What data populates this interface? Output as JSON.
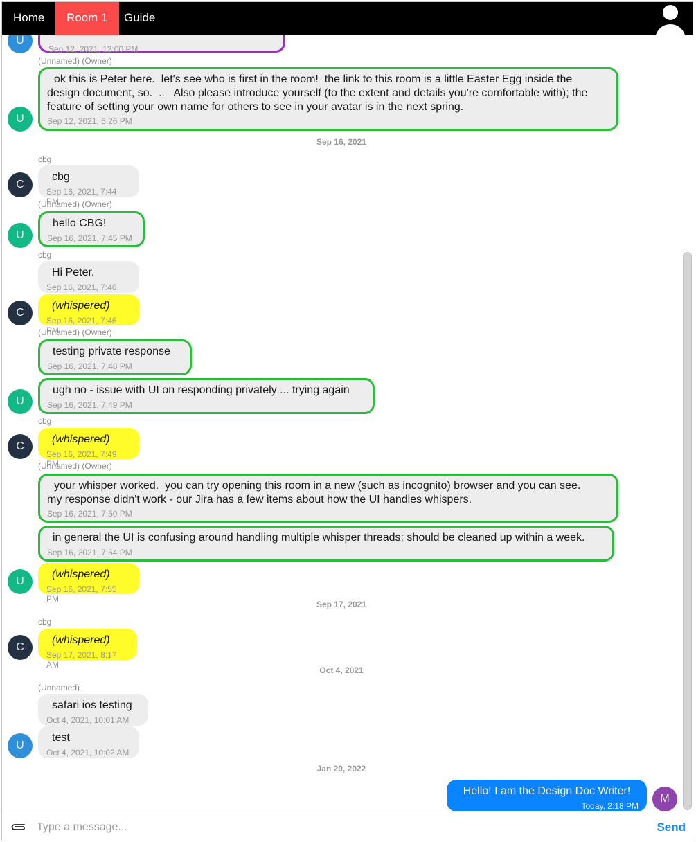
{
  "nav": {
    "tabs": [
      {
        "label": "Home"
      },
      {
        "label": "Room 1"
      },
      {
        "label": "Guide"
      }
    ]
  },
  "messages": {
    "m0": {
      "ts": "Sep 12, 2021, 12:00 PM",
      "avatar": "U"
    },
    "m1": {
      "author": "(Unnamed) (Owner)",
      "text": "ok this is Peter here.  let's see who is first in the room!  the link to this room is a little Easter Egg inside the\ndesign document, so.  ..   Also please introduce yourself (to the extent and details you're comfortable with); the\nfeature of setting your own name for others to see in your avatar is in the next spring.",
      "ts": "Sep 12, 2021, 6:26 PM",
      "avatar": "U"
    },
    "d1": "Sep 16, 2021",
    "m2": {
      "author": "cbg",
      "text": "cbg",
      "ts": "Sep 16, 2021, 7:44 PM",
      "avatar": "C"
    },
    "m3": {
      "author": "(Unnamed) (Owner)",
      "text": "hello CBG!",
      "ts": "Sep 16, 2021, 7:45 PM",
      "avatar": "U"
    },
    "m4": {
      "author": "cbg",
      "text": "Hi Peter.",
      "ts": "Sep 16, 2021, 7:46 PM"
    },
    "m5": {
      "text": "(whispered)",
      "ts": "Sep 16, 2021, 7:46 PM",
      "avatar": "C"
    },
    "m6": {
      "author": "(Unnamed) (Owner)",
      "text": "testing private response",
      "ts": "Sep 16, 2021, 7:48 PM"
    },
    "m7": {
      "text": "ugh no - issue with UI on responding privately ... trying again",
      "ts": "Sep 16, 2021, 7:49 PM",
      "avatar": "U"
    },
    "m8": {
      "author": "cbg",
      "text": "(whispered)",
      "ts": "Sep 16, 2021, 7:49 PM",
      "avatar": "C"
    },
    "m9": {
      "author": "(Unnamed) (Owner)",
      "text": "your whisper worked.  you can try opening this room in a new (such as incognito) browser and you can see.\nmy response didn't work - our Jira has a few items about how the UI handles whispers.",
      "ts": "Sep 16, 2021, 7:50 PM"
    },
    "m10": {
      "text": "in general the UI is confusing around handling multiple whisper threads; should be cleaned up within a week.",
      "ts": "Sep 16, 2021, 7:54 PM"
    },
    "m11": {
      "text": "(whispered)",
      "ts": "Sep 16, 2021, 7:55 PM",
      "avatar": "U"
    },
    "d2": "Sep 17, 2021",
    "m12": {
      "author": "cbg",
      "text": "(whispered)",
      "ts": "Sep 17, 2021, 8:17 AM",
      "avatar": "C"
    },
    "d3": "Oct 4, 2021",
    "m13": {
      "author": "(Unnamed)",
      "text": "safari ios testing",
      "ts": "Oct 4, 2021, 10:01 AM"
    },
    "m14": {
      "text": "test",
      "ts": "Oct 4, 2021, 10:02 AM",
      "avatar": "U"
    },
    "d4": "Jan 20, 2022",
    "m15": {
      "text": "Hello!  I am the Design Doc Writer!",
      "ts": "Today, 2:18 PM",
      "avatar": "M"
    }
  },
  "composer": {
    "placeholder": "Type a message...",
    "send_label": "Send"
  },
  "colors": {
    "nav_bg": "#000000",
    "active_tab": "#fc4a4a",
    "owner_border": "#2cbc3b",
    "whisper_bg": "#fffc29",
    "my_bubble": "#0b84ff",
    "send": "#1b84e8"
  }
}
